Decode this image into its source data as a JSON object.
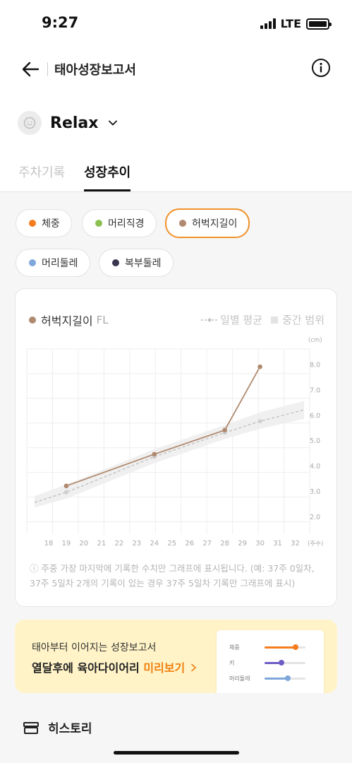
{
  "status_bar": {
    "time": "9:27",
    "network": "LTE"
  },
  "header": {
    "title": "태아성장보고서"
  },
  "baby": {
    "name": "Relax"
  },
  "tabs": [
    {
      "label": "주차기록",
      "active": false
    },
    {
      "label": "성장추이",
      "active": true
    }
  ],
  "chips": [
    {
      "label": "체중",
      "color": "#f57c1f",
      "active": false
    },
    {
      "label": "머리직경",
      "color": "#8cc152",
      "active": false
    },
    {
      "label": "허벅지길이",
      "color": "#b08a70",
      "active": true
    },
    {
      "label": "머리둘레",
      "color": "#7fa7dc",
      "active": false
    },
    {
      "label": "복부둘레",
      "color": "#3b3550",
      "active": false
    }
  ],
  "chart": {
    "series_label": "허벅지길이",
    "series_abbr": "FL",
    "legend_avg": "일별 평균",
    "legend_range": "중간 범위",
    "note": "ⓘ 주중 가장 마지막에 기록한 수치만 그래프에 표시됩니다. (예: 37주 0일차, 37주 5일차 2개의 기록이 있는 경우 37주 5일차 기록만 그래프에 표시)"
  },
  "chart_data": {
    "type": "line",
    "title": "허벅지길이 FL",
    "xlabel": "(주수)",
    "ylabel": "(cm)",
    "x_ticks": [
      18,
      19,
      20,
      21,
      22,
      23,
      24,
      25,
      26,
      27,
      28,
      29,
      30,
      31,
      32
    ],
    "y_ticks": [
      "2.0",
      "3.0",
      "4.0",
      "5.0",
      "6.0",
      "7.0",
      "8.0"
    ],
    "xlim": [
      17.2,
      32.7
    ],
    "ylim": [
      1.3,
      8.6
    ],
    "series": [
      {
        "name": "허벅지길이",
        "color": "#b08a70",
        "style": "solid",
        "x": [
          19,
          24,
          28,
          30
        ],
        "y": [
          3.2,
          4.45,
          5.4,
          7.9
        ]
      },
      {
        "name": "일별 평균",
        "color": "#c4c4c4",
        "style": "dashed",
        "x": [
          17.2,
          19,
          24,
          28,
          30,
          32.5
        ],
        "y": [
          2.55,
          2.95,
          4.35,
          5.3,
          5.75,
          6.2
        ]
      }
    ],
    "range_band": {
      "name": "중간 범위",
      "x": [
        17.2,
        19,
        24,
        28,
        30,
        32.5
      ],
      "lower": [
        2.35,
        2.7,
        4.1,
        5.05,
        5.45,
        5.85
      ],
      "upper": [
        2.8,
        3.25,
        4.65,
        5.6,
        6.1,
        6.55
      ]
    },
    "grid": true,
    "legend_position": "top-right"
  },
  "promo": {
    "subtitle": "태아부터 이어지는 성장보고서",
    "title": "열달후에 육아다이어리",
    "cta": "미리보기",
    "preview_rows": [
      {
        "label": "체중",
        "color": "#f57c1f",
        "level": 0.75
      },
      {
        "label": "키",
        "color": "#6e5cc4",
        "level": 0.4
      },
      {
        "label": "머리둘레",
        "color": "#7fa7dc",
        "level": 0.55
      }
    ]
  },
  "bottom": {
    "label": "히스토리"
  }
}
